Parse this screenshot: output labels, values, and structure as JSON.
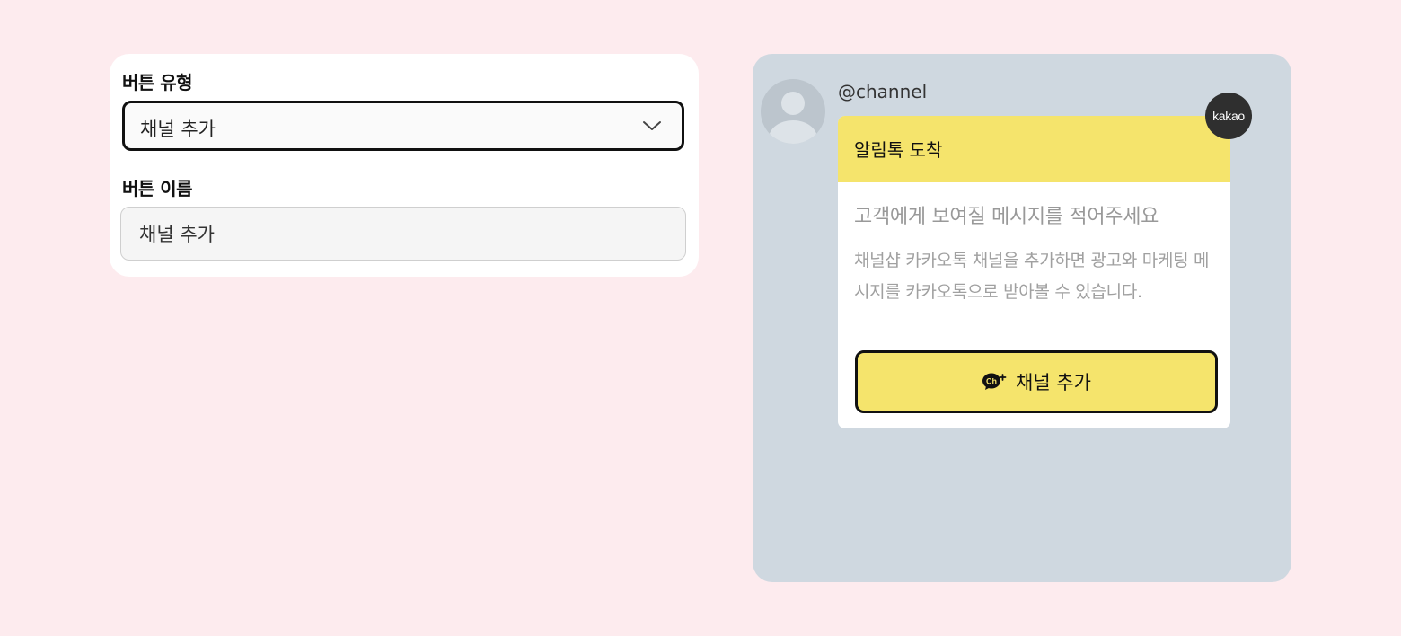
{
  "form": {
    "button_type": {
      "label": "버튼 유형",
      "selected_value": "채널 추가"
    },
    "button_name": {
      "label": "버튼 이름",
      "value": "채널 추가"
    }
  },
  "preview": {
    "channel_name": "@channel",
    "badge": "kakao",
    "header_title": "알림톡 도착",
    "message_title": "고객에게 보여질 메시지를 적어주세요",
    "message_body": "채널샵 카카오톡 채널을 추가하면 광고와 마케팅 메시지를 카카오톡으로 받아볼 수 있습니다.",
    "button_label": "채널 추가",
    "button_icon": "channel-add-icon"
  },
  "colors": {
    "page_background": "#fdebee",
    "preview_background": "#cfd8e0",
    "kakao_yellow": "#f5e46c",
    "badge_background": "#2f2f2f"
  }
}
